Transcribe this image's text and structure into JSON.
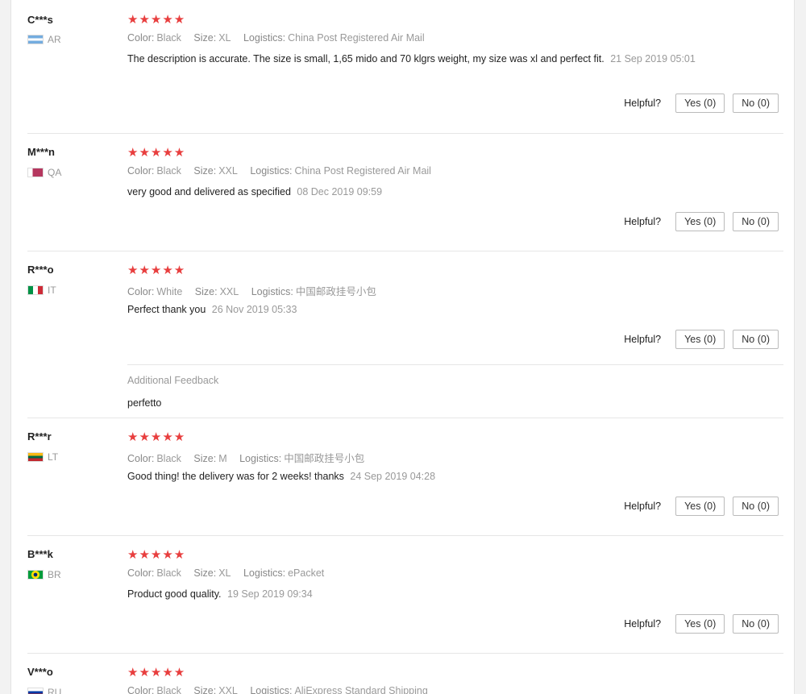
{
  "labels": {
    "color": "Color:",
    "size": "Size:",
    "logistics": "Logistics:",
    "helpful": "Helpful?",
    "additional_feedback": "Additional Feedback"
  },
  "stars_glyph": "★★★★★",
  "accent_color": "#e83e3e",
  "reviews": [
    {
      "user": "C***s",
      "country": "AR",
      "rating": 5,
      "color": "Black",
      "size": "XL",
      "logistics": "China Post Registered Air Mail",
      "text": "The description is accurate. The size is small, 1,65 mido and 70 klgrs weight, my size was xl and perfect fit.",
      "date": "21 Sep 2019 05:01",
      "yes": "Yes (0)",
      "no": "No (0)"
    },
    {
      "user": "M***n",
      "country": "QA",
      "rating": 5,
      "color": "Black",
      "size": "XXL",
      "logistics": "China Post Registered Air Mail",
      "text": "very good and delivered as specified",
      "date": "08 Dec 2019 09:59",
      "yes": "Yes (0)",
      "no": "No (0)"
    },
    {
      "user": "R***o",
      "country": "IT",
      "rating": 5,
      "color": "White",
      "size": "XXL",
      "logistics": "中国邮政挂号小包",
      "text": "Perfect thank you",
      "date": "26 Nov 2019 05:33",
      "yes": "Yes (0)",
      "no": "No (0)",
      "additional": "perfetto"
    },
    {
      "user": "R***r",
      "country": "LT",
      "rating": 5,
      "color": "Black",
      "size": "M",
      "logistics": "中国邮政挂号小包",
      "text": "Good thing! the delivery was for 2 weeks! thanks",
      "date": "24 Sep 2019 04:28",
      "yes": "Yes (0)",
      "no": "No (0)"
    },
    {
      "user": "B***k",
      "country": "BR",
      "rating": 5,
      "color": "Black",
      "size": "XL",
      "logistics": "ePacket",
      "text": "Product good quality.",
      "date": "19 Sep 2019 09:34",
      "yes": "Yes (0)",
      "no": "No (0)"
    },
    {
      "user": "V***o",
      "country": "RU",
      "rating": 5,
      "color": "Black",
      "size": "XXL",
      "logistics": "AliExpress Standard Shipping"
    }
  ]
}
